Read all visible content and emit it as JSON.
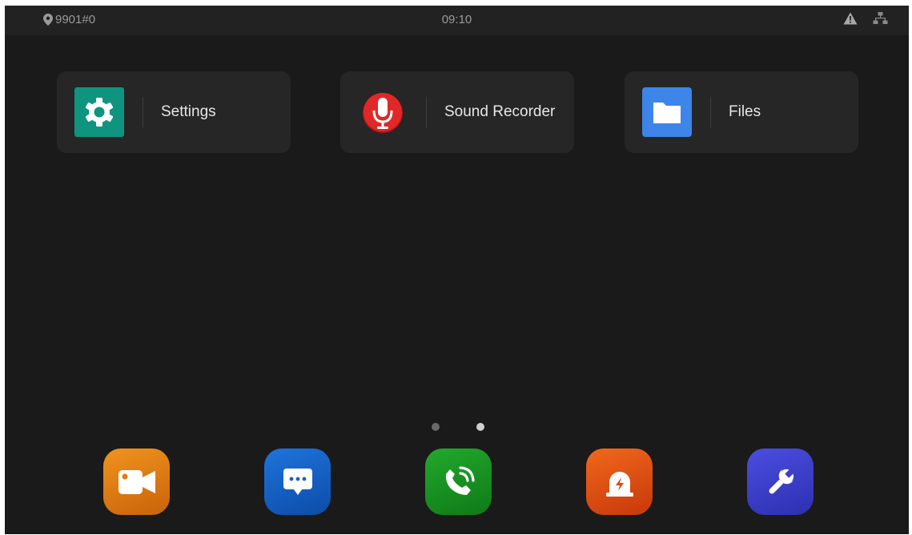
{
  "statusbar": {
    "location": "9901#0",
    "time": "09:10",
    "icons": [
      "location-pin-icon",
      "warning-icon",
      "network-icon"
    ]
  },
  "apps": [
    {
      "label": "Settings",
      "icon": "gear-icon",
      "color": "#0f9480"
    },
    {
      "label": "Sound Recorder",
      "icon": "microphone-icon",
      "color": "#d42020"
    },
    {
      "label": "Files",
      "icon": "folder-icon",
      "color": "#3d85e8"
    }
  ],
  "page_indicator": {
    "pages": 2,
    "current": 2
  },
  "dock": [
    {
      "icon": "video-camera-icon",
      "color": "#e07a12"
    },
    {
      "icon": "message-icon",
      "color": "#1760c8"
    },
    {
      "icon": "phone-call-icon",
      "color": "#16901f"
    },
    {
      "icon": "alarm-icon",
      "color": "#e0480f"
    },
    {
      "icon": "wrench-icon",
      "color": "#3b3fc9"
    }
  ],
  "colors": {
    "background": "#1a1a1a",
    "tile": "#262626",
    "text": "#e6e6e6",
    "statusText": "#9a9a9a"
  }
}
